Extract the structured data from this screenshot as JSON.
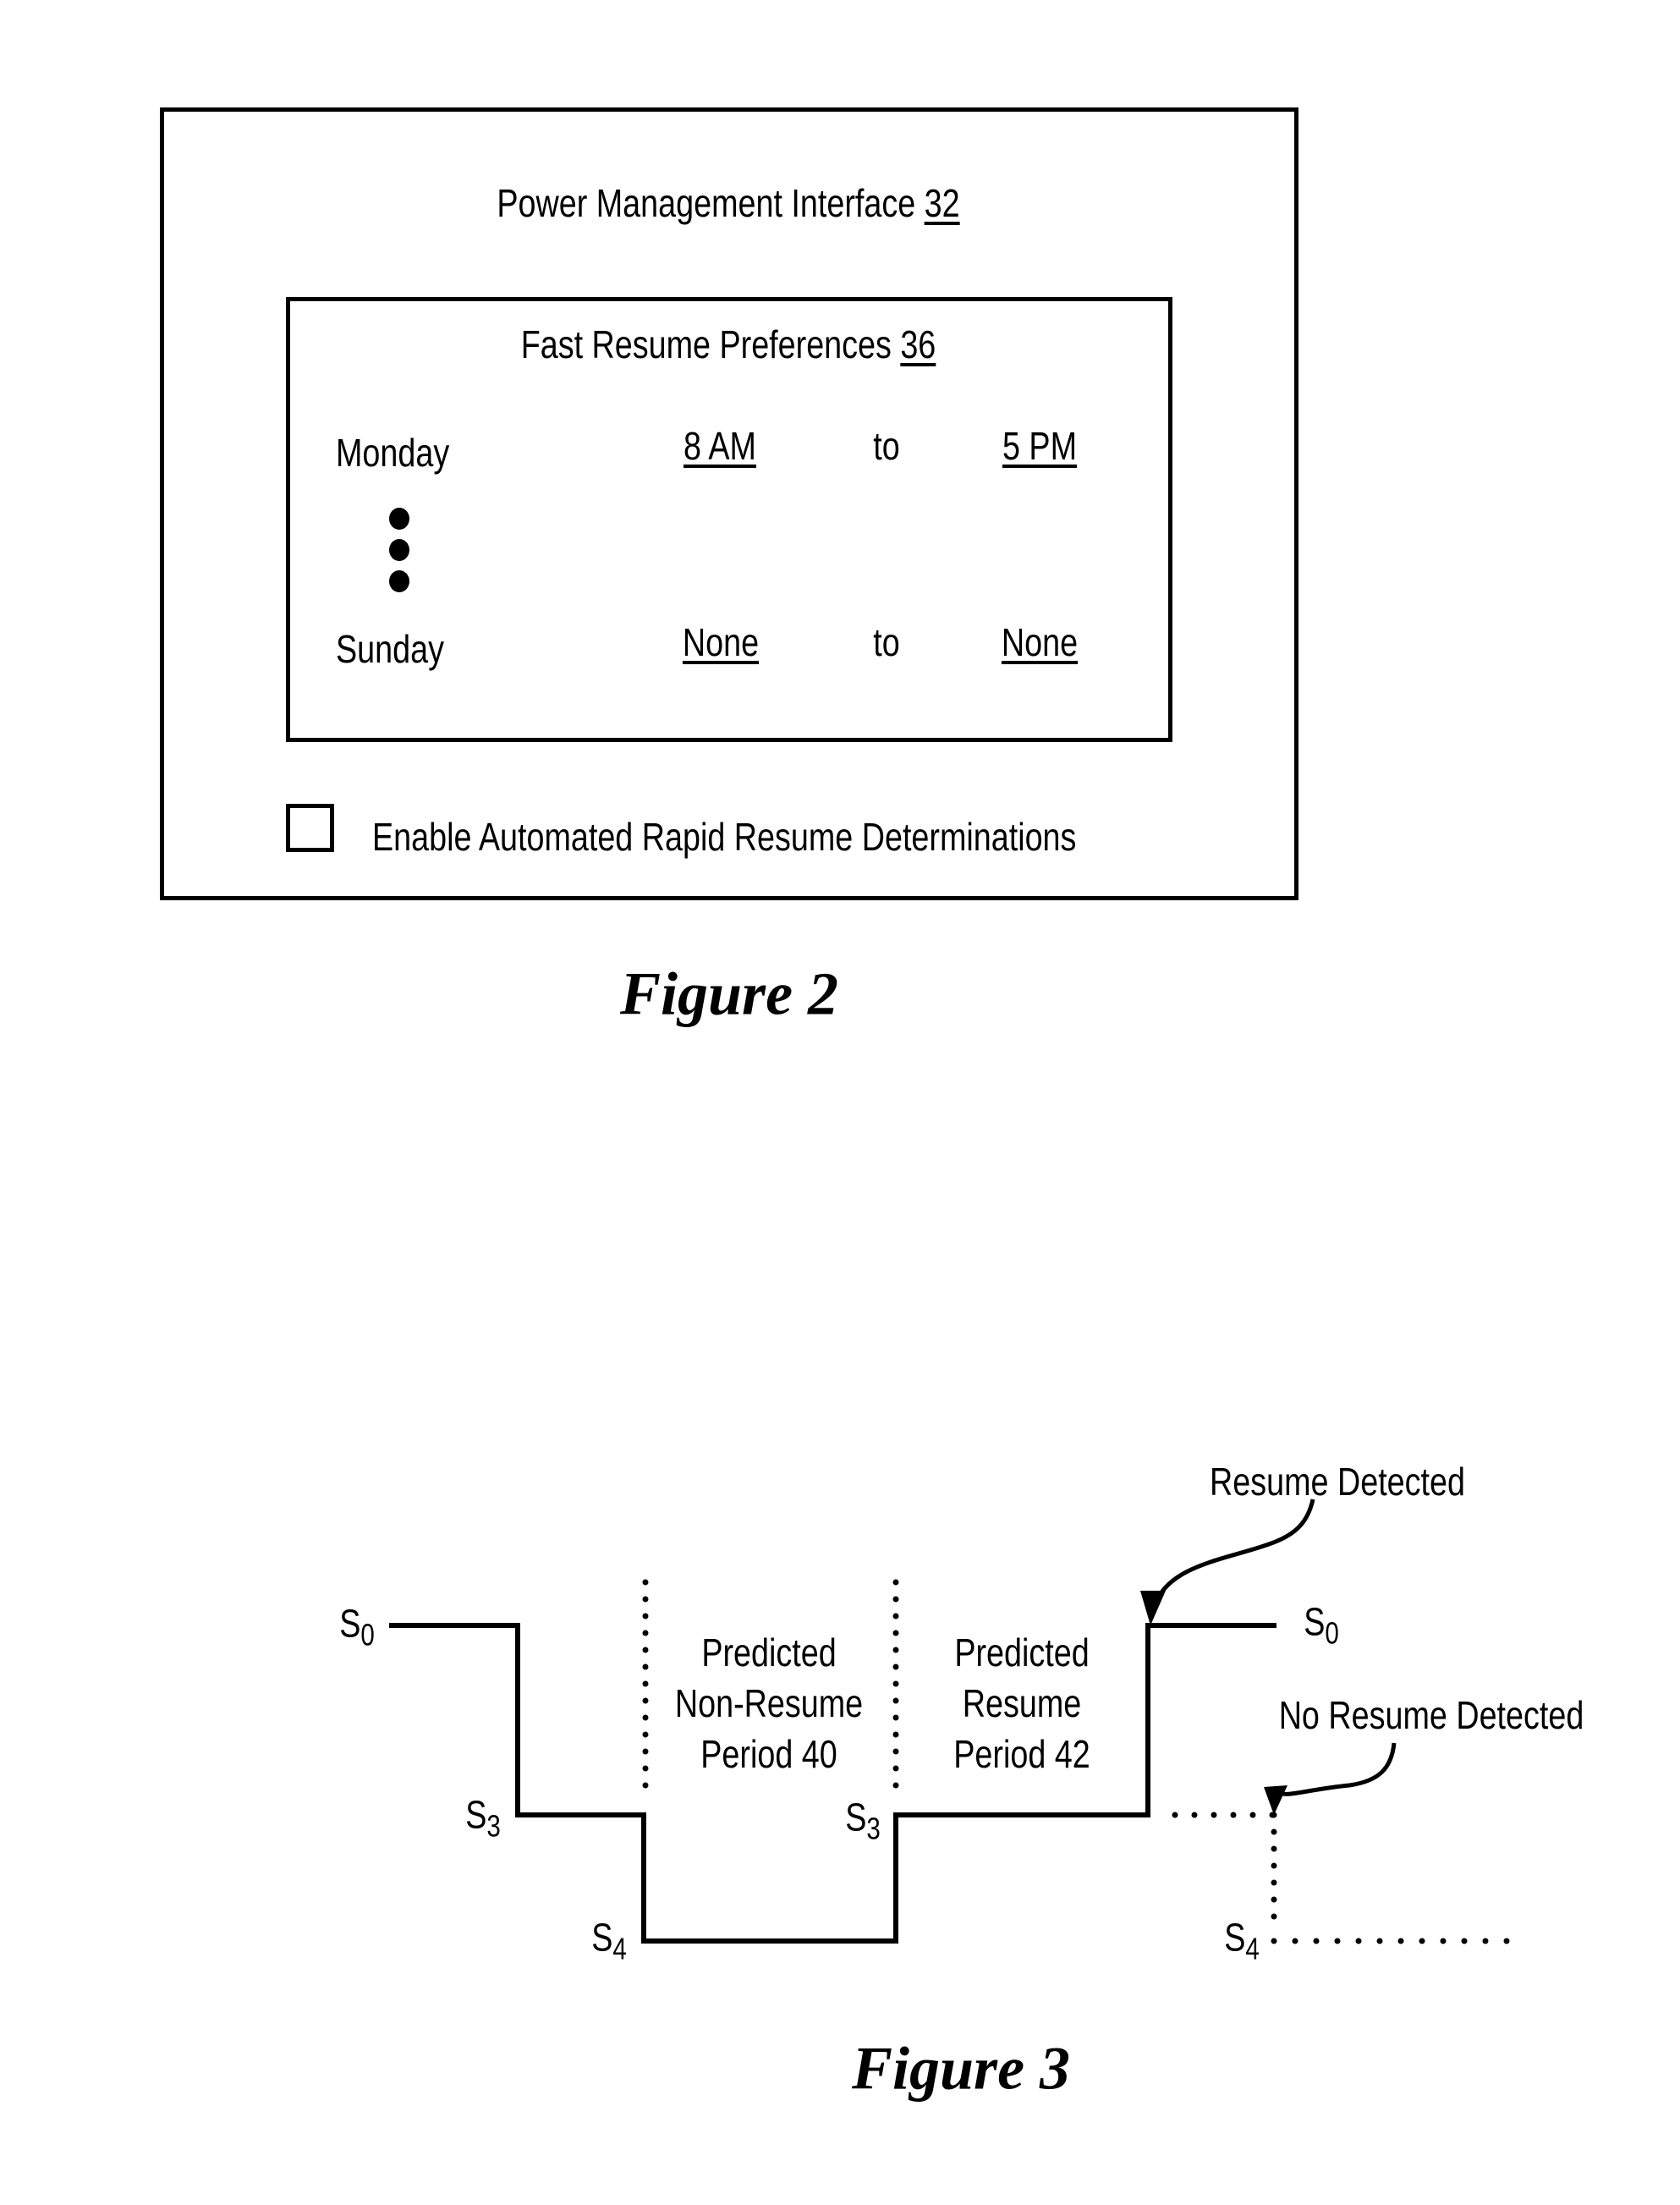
{
  "figure2": {
    "caption": "Figure 2",
    "interface": {
      "title": "Power Management Interface",
      "ref": "32"
    },
    "preferences": {
      "title": "Fast Resume Preferences",
      "ref": "36",
      "rows": [
        {
          "day": "Monday",
          "start": "8 AM",
          "separator": "to",
          "end": "5 PM"
        },
        {
          "day": "Sunday",
          "start": "None",
          "separator": "to",
          "end": "None"
        }
      ],
      "ellipsis_icon": "vertical-ellipsis"
    },
    "checkbox": {
      "label": "Enable Automated Rapid Resume Determinations",
      "checked": false
    }
  },
  "figure3": {
    "caption": "Figure 3",
    "state_labels": {
      "s0_left": {
        "base": "S",
        "sub": "0"
      },
      "s3_left": {
        "base": "S",
        "sub": "3"
      },
      "s4_mid": {
        "base": "S",
        "sub": "4"
      },
      "s3_mid": {
        "base": "S",
        "sub": "3"
      },
      "s0_right": {
        "base": "S",
        "sub": "0"
      },
      "s4_right": {
        "base": "S",
        "sub": "4"
      }
    },
    "periods": [
      {
        "lines": [
          "Predicted",
          "Non-Resume",
          "Period 40"
        ]
      },
      {
        "lines": [
          "Predicted",
          "Resume",
          "Period 42"
        ]
      }
    ],
    "annotations": {
      "resume_detected": "Resume Detected",
      "no_resume_detected": "No Resume Detected"
    },
    "sequence": [
      "S0",
      "S3",
      "S4",
      "S3",
      "S0"
    ],
    "alt_sequence_end": [
      "S3",
      "S4"
    ]
  }
}
